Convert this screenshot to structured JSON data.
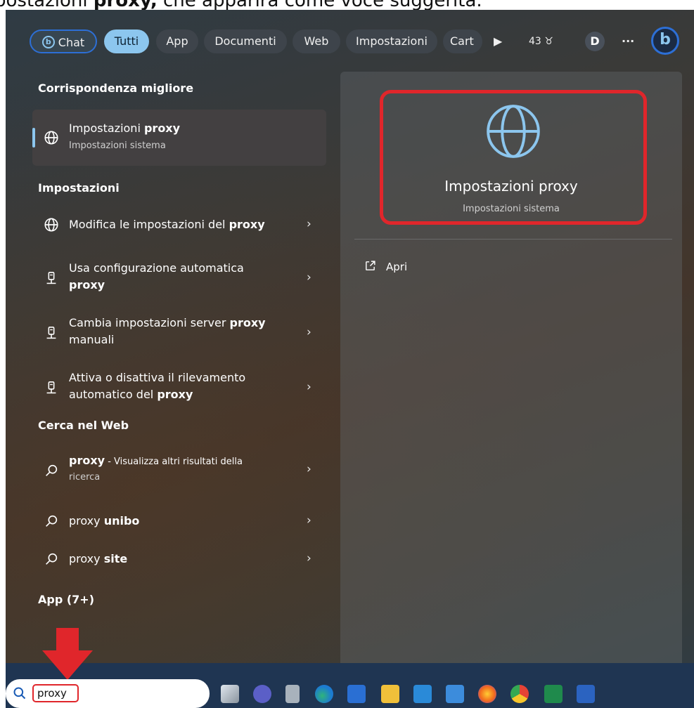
{
  "caption": {
    "prefix": "postazioni ",
    "bold": "proxy,",
    "rest": " che apparirà come voce suggerita."
  },
  "topbar": {
    "chat": "Chat",
    "tabs": [
      "Tutti",
      "App",
      "Documenti",
      "Web",
      "Impostazioni",
      "Cart"
    ],
    "count": "43",
    "avatar": "D",
    "more": "···"
  },
  "left": {
    "best_header": "Corrispondenza migliore",
    "best": {
      "title_prefix": "Impostazioni ",
      "title_bold": "proxy",
      "subtitle": "Impostazioni sistema"
    },
    "settings_header": "Impostazioni",
    "settings": [
      {
        "line1": "Modifica le impostazioni del ",
        "bold": "proxy",
        "line2": ""
      },
      {
        "line1": "Usa configurazione automatica",
        "bold": "proxy",
        "line2": ""
      },
      {
        "line1": "Cambia impostazioni server ",
        "bold": "proxy",
        "line2": "manuali"
      },
      {
        "line1": "Attiva o disattiva il rilevamento",
        "line2_prefix": "automatico del ",
        "bold": "proxy"
      }
    ],
    "web_header": "Cerca nel Web",
    "web": [
      {
        "bold": "proxy",
        "rest": " - Visualizza altri risultati della",
        "line2": "ricerca"
      },
      {
        "text": "proxy ",
        "bold": "unibo"
      },
      {
        "text": "proxy ",
        "bold": "site"
      }
    ],
    "apps_header": "App (7+)"
  },
  "right": {
    "title": "Impostazioni proxy",
    "subtitle": "Impostazioni sistema",
    "action": "Apri"
  },
  "search": {
    "query": "proxy"
  },
  "colors": {
    "accent": "#8cc6ee",
    "highlight": "#e0262b",
    "taskbar": "#1f3552"
  }
}
